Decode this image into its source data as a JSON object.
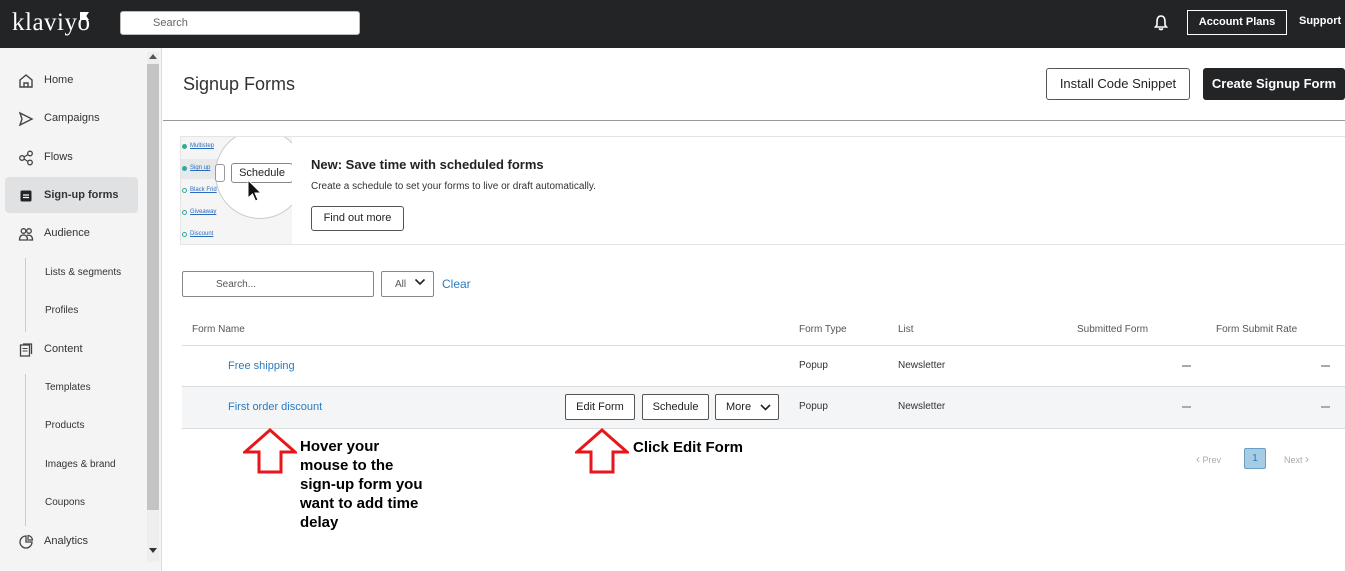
{
  "topbar": {
    "logo": "klaviyo",
    "search_placeholder": "Search",
    "account_plans": "Account Plans",
    "support": "Support"
  },
  "sidebar": {
    "items": [
      {
        "label": "Home",
        "icon": "home-icon"
      },
      {
        "label": "Campaigns",
        "icon": "send-icon"
      },
      {
        "label": "Flows",
        "icon": "flow-icon"
      },
      {
        "label": "Sign-up forms",
        "icon": "form-icon",
        "active": true
      },
      {
        "label": "Audience",
        "icon": "people-icon"
      },
      {
        "label": "Content",
        "icon": "content-icon"
      },
      {
        "label": "Analytics",
        "icon": "chart-icon"
      }
    ],
    "audience_sub": [
      "Lists & segments",
      "Profiles"
    ],
    "content_sub": [
      "Templates",
      "Products",
      "Images & brand",
      "Coupons"
    ]
  },
  "header": {
    "title": "Signup Forms",
    "install_btn": "Install Code Snippet",
    "create_btn": "Create Signup Form"
  },
  "banner": {
    "image_items": [
      "Multistep",
      "Sign up",
      "Black Frid",
      "Giveaway",
      "Discount"
    ],
    "image_button": "Schedule",
    "title": "New: Save time with scheduled forms",
    "description": "Create a schedule to set your forms to live or draft automatically.",
    "button": "Find out more"
  },
  "filters": {
    "search_placeholder": "Search...",
    "select_value": "All",
    "clear": "Clear"
  },
  "table": {
    "headers": [
      "Form Name",
      "Form Type",
      "List",
      "Submitted Form",
      "Form Submit Rate"
    ],
    "rows": [
      {
        "name": "Free shipping",
        "type": "Popup",
        "list": "Newsletter"
      },
      {
        "name": "First order discount",
        "type": "Popup",
        "list": "Newsletter"
      }
    ],
    "row_actions": {
      "edit": "Edit Form",
      "schedule": "Schedule",
      "more": "More"
    }
  },
  "annotations": {
    "hover": [
      "Hover your",
      "mouse to the",
      "sign-up form you",
      "want to add time",
      "delay"
    ],
    "click": "Click Edit Form",
    "arrow_color": "#e8161b"
  },
  "pagination": {
    "prev": "Prev",
    "page": "1",
    "next": "Next"
  }
}
